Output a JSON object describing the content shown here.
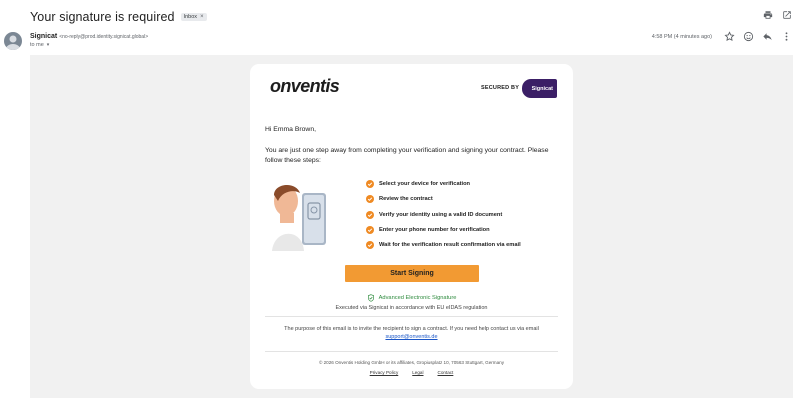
{
  "email": {
    "subject": "Your signature is required",
    "label_chip": "Inbox",
    "label_chip_close": "×",
    "sender_name": "Signicat",
    "sender_address": "<no-reply@prod.identity.signicat.global>",
    "recipient_line": "to me",
    "timestamp": "4:58 PM (4 minutes ago)"
  },
  "toolbar_icons": {
    "print": "printer-icon",
    "open_new_window": "open-in-new-window-icon",
    "star": "star-icon",
    "react": "emoji-icon",
    "reply": "reply-icon",
    "more": "more-vert-icon"
  },
  "body": {
    "logo_text": "onventis",
    "secured_by": "SECURED BY",
    "signicat_badge": "Signicat",
    "greeting": "Hi Emma Brown,",
    "intro": "You are just one step away from completing your verification and signing your contract. Please follow these steps:",
    "steps": [
      "Select your device for verification",
      "Review the contract",
      "Verify your identity using a valid ID document",
      "Enter your phone number for verification",
      "Wait for the verification result confirmation via email"
    ],
    "cta_label": "Start Signing",
    "aes_label": "Advanced Electronic Signature",
    "executed_text": "Executed via Signicat in accordance with EU eIDAS regulation",
    "purpose_text": "The purpose of this email is to invite the recipient to sign a contract. If you need help contact us via email",
    "support_email": "support@onventis.de",
    "copyright": "© 2026 Onventis Holding GmbH or its affiliates, Gropiusplatz 10, 70563 Stuttgart, Germany",
    "footer_links": [
      "Privacy Policy",
      "Legal",
      "Contact"
    ]
  },
  "colors": {
    "accent_orange": "#f29a33",
    "check_orange": "#ef8a23",
    "signicat_purple": "#3b1f66",
    "aes_green": "#2e8b3e",
    "link_blue": "#1a56c7"
  }
}
